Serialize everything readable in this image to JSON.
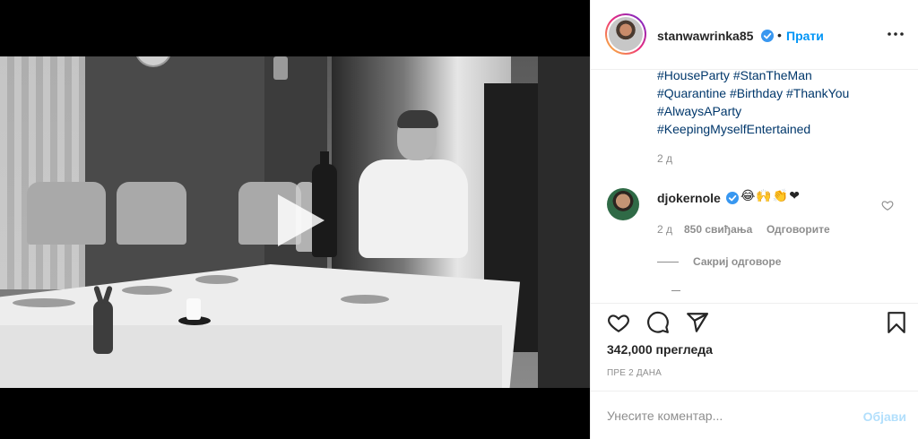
{
  "header": {
    "username": "stanwawrinka85",
    "separator": "•",
    "follow_label": "Прати",
    "avatar_icon": "profile-avatar",
    "verified_icon": "verified-badge-icon",
    "more_icon": "more-options-icon"
  },
  "caption": {
    "hashtags": [
      "#HouseParty #StanTheMan",
      "#Quarantine #Birthday #ThankYou",
      "#AlwaysAParty",
      "#KeepingMyselfEntertained"
    ],
    "time": "2 д"
  },
  "comment": {
    "username": "djokernole",
    "text": "😂🙌👏❤",
    "time": "2 д",
    "likes": "850 свиђања",
    "reply_label": "Одговорите",
    "hide_replies_label": "Сакриј одговоре"
  },
  "actions": {
    "views": "342,000 прегледа",
    "posted": "ПРЕ 2 ДАНА"
  },
  "comment_box": {
    "placeholder": "Унесите коментар...",
    "post_label": "Објави"
  },
  "colors": {
    "link_blue": "#0095f6",
    "hashtag_blue": "#00376b",
    "muted_gray": "#8e8e8e",
    "post_disabled": "#b2dffc",
    "heart_red": "#ed4956"
  }
}
